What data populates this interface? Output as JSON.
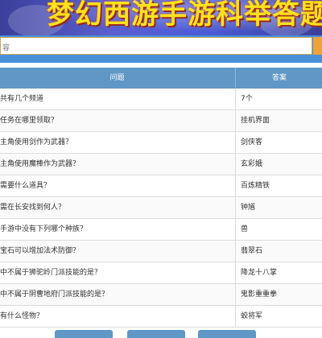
{
  "banner": {
    "title": "梦幻西游手游科举答题"
  },
  "search": {
    "placeholder": "容"
  },
  "table": {
    "headers": {
      "question": "问题",
      "answer": "答案"
    },
    "rows": [
      {
        "question": "共有几个频道",
        "answer": "7个"
      },
      {
        "question": "任务在哪里领取？",
        "answer": "挂机界面"
      },
      {
        "question": "主角使用剑作为武器？",
        "answer": "剑侠客"
      },
      {
        "question": "主角使用魔棒作为武器？",
        "answer": "玄彩娥"
      },
      {
        "question": "需要什么道具？",
        "answer": "百炼精铁"
      },
      {
        "question": "需在长安找到何人？",
        "answer": "钟馗"
      },
      {
        "question": "手游中没有下列哪个种族？",
        "answer": "兽"
      },
      {
        "question": "宝石可以增加法术防御？",
        "answer": "翡翠石"
      },
      {
        "question": "中不属于狮驼岭门派技能的是？",
        "answer": "降龙十八掌"
      },
      {
        "question": "中不属于阴曹地府门派技能的是？",
        "answer": "鬼影重重拳"
      },
      {
        "question": "有什么怪物？",
        "answer": "蛟将军"
      }
    ]
  },
  "colors": {
    "header_bg": "#5f97c6",
    "search_bar_bg": "#4a90d9",
    "search_button": "#f0a23a",
    "title_text": "#ffe21a"
  }
}
